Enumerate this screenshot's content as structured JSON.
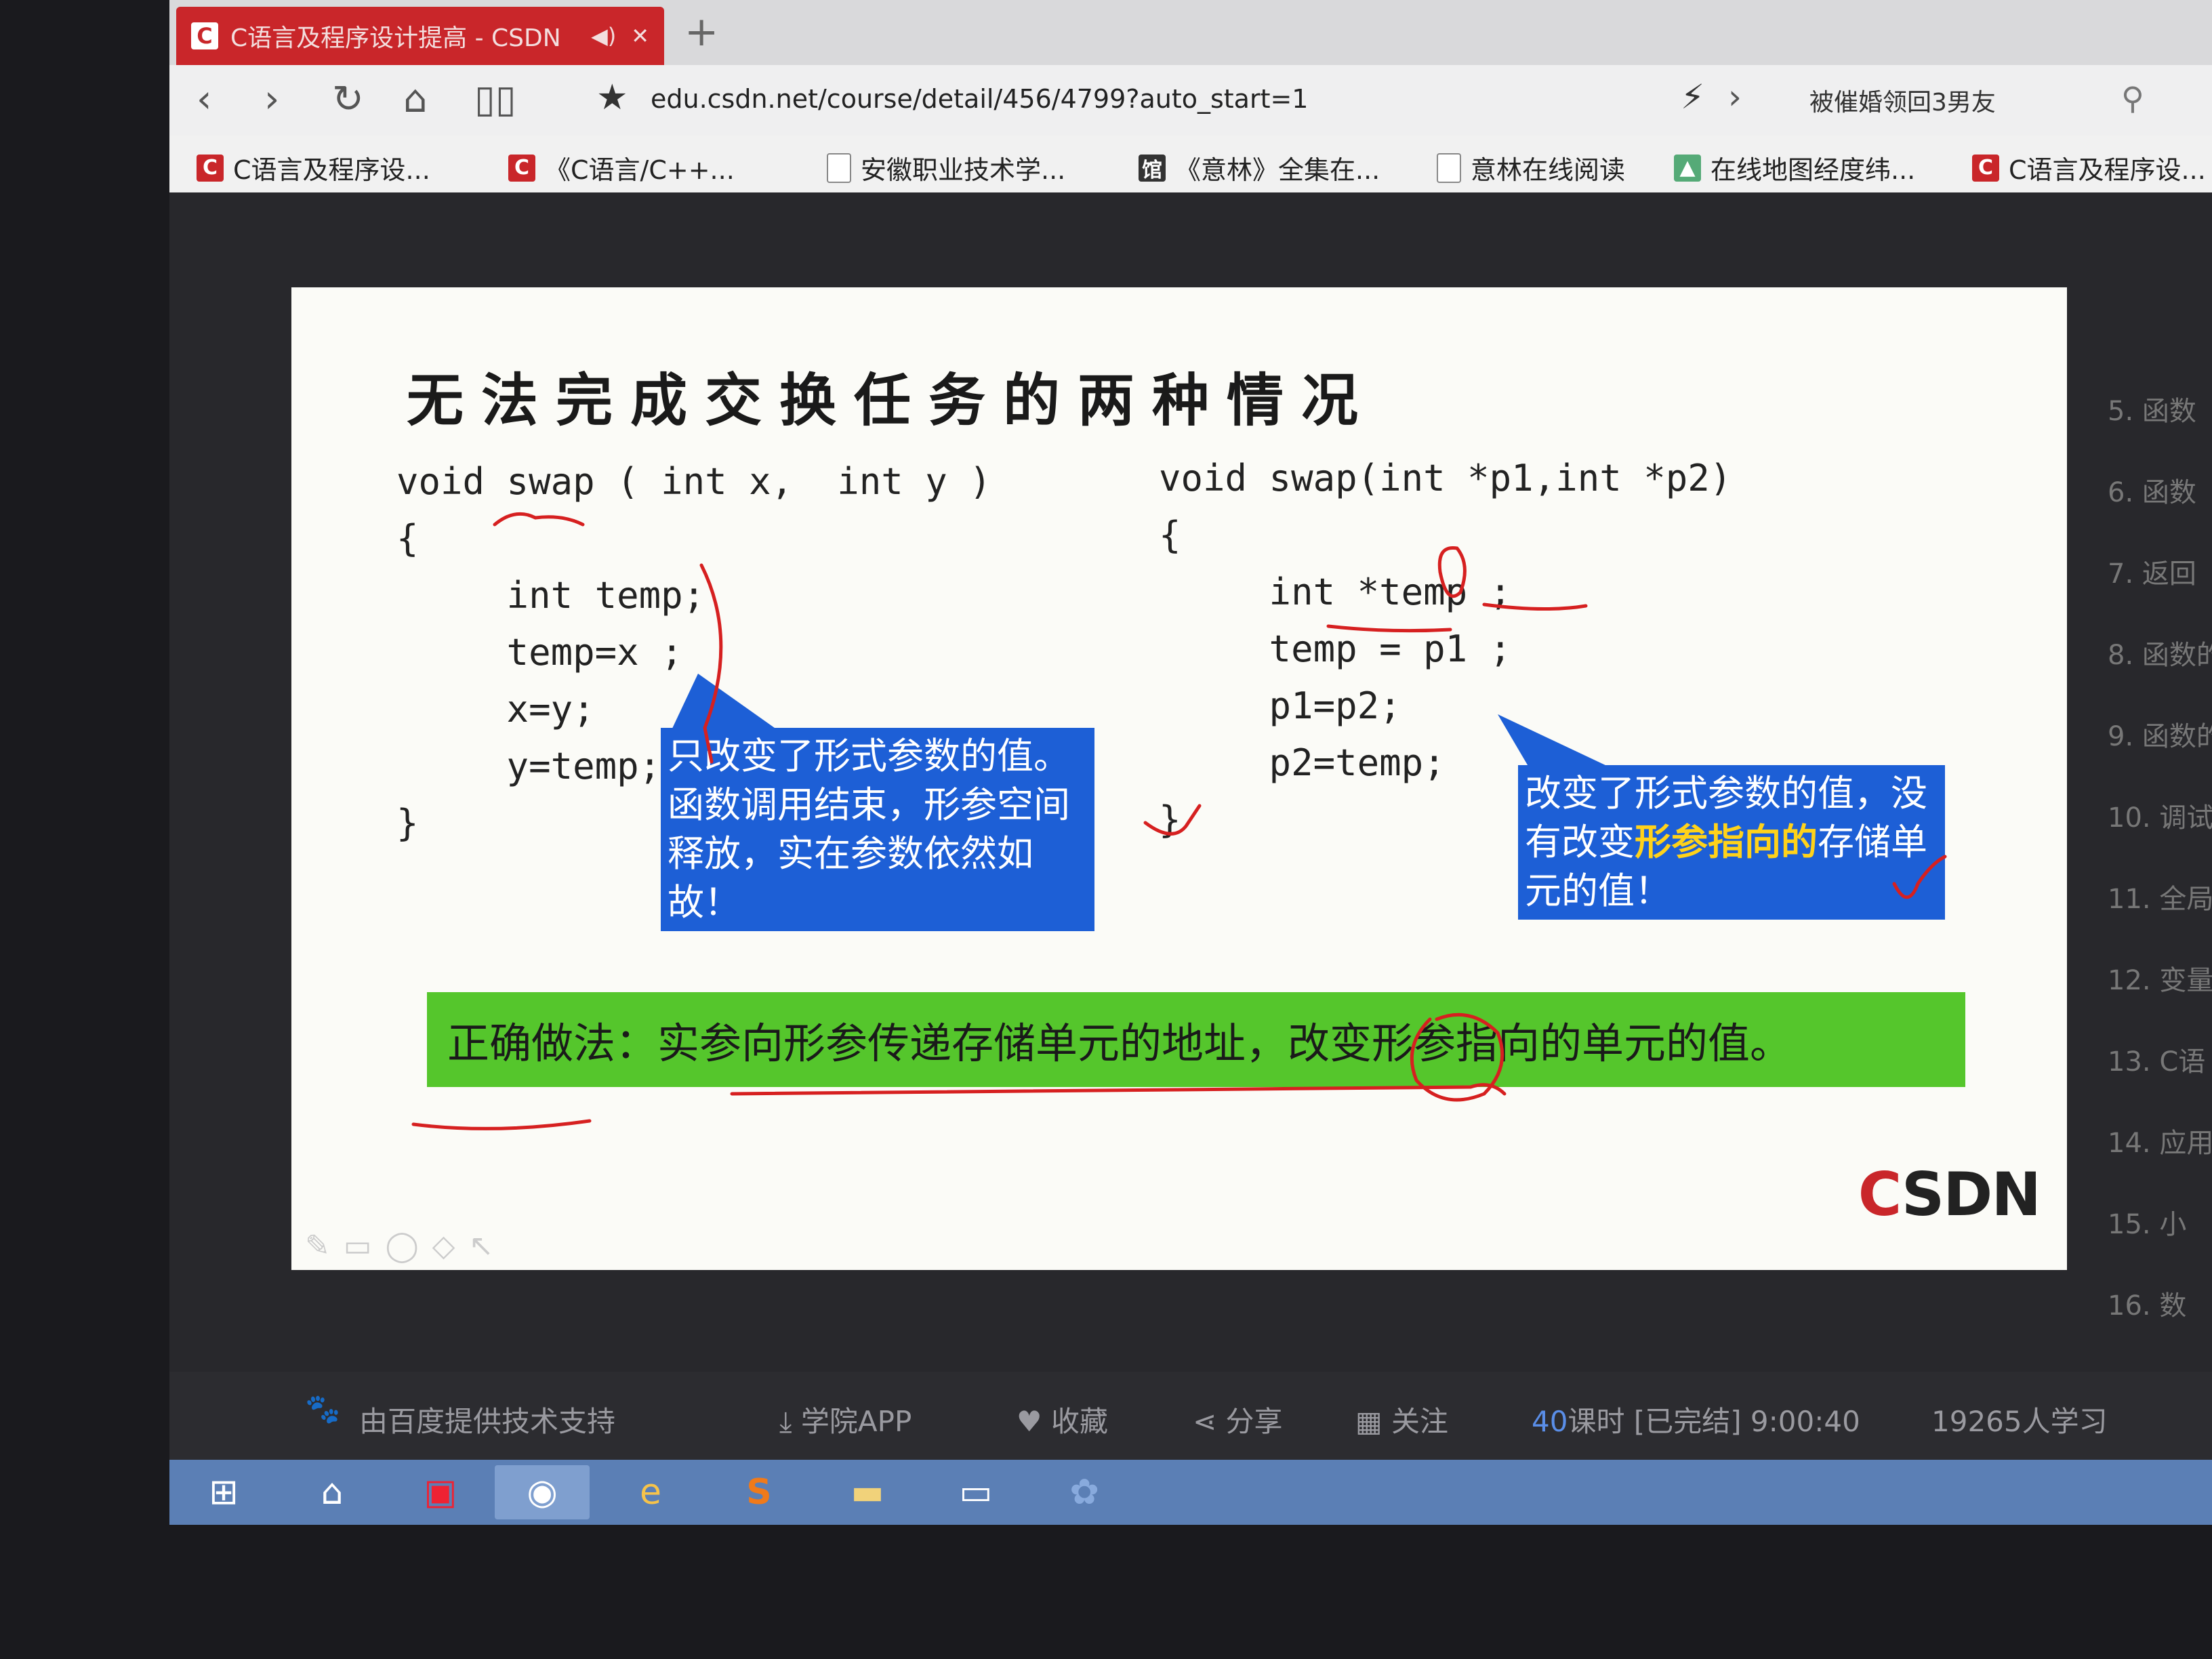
{
  "browser": {
    "tab_title": "C语言及程序设计提高 - CSDN",
    "tab_sound": "◀)",
    "tab_close": "✕",
    "new_tab": "+",
    "url": "edu.csdn.net/course/detail/456/4799?auto_start=1",
    "hot_search": "被催婚领回3男友"
  },
  "bookmarks": [
    {
      "label": "C语言及程序设...",
      "icon": "csdn-icon"
    },
    {
      "label": "《C语言/C++...",
      "icon": "csdn-icon"
    },
    {
      "label": "安徽职业技术学...",
      "icon": "page-icon"
    },
    {
      "label": "《意林》全集在...",
      "icon": "library-icon"
    },
    {
      "label": "意林在线阅读",
      "icon": "page-icon"
    },
    {
      "label": "在线地图经度纬...",
      "icon": "map-icon"
    },
    {
      "label": "C语言及程序设...",
      "icon": "csdn-icon"
    }
  ],
  "slide": {
    "title": "无法完成交换任务的两种情况",
    "left_code": "void swap ( int x,  int y )\n{\n     int temp;\n     temp=x ;\n     x=y;\n     y=temp;\n}",
    "right_code": "void swap(int *p1,int *p2)\n{\n     int *temp ;\n     temp = p1 ;\n     p1=p2;\n     p2=temp;\n}",
    "left_note": "只改变了形式参数的值。函数调用结束，形参空间释放，实在参数依然如故！",
    "right_note_a": "改变了形式参数的值，没有改变",
    "right_note_highlight": "形参指向的",
    "right_note_b": "存储单元的值！",
    "correct_method": "正确做法：实参向形参传递存储单元的地址，改变形参指向的单元的值。",
    "logo_c": "C",
    "logo_rest": "SDN"
  },
  "chapters": [
    "5. 函数",
    "6. 函数",
    "7. 返回",
    "8. 函数的",
    "9. 函数的",
    "10. 调试",
    "11. 全局",
    "12. 变量",
    "13. C语",
    "14. 应用",
    "15. 小",
    "16. 数"
  ],
  "player_bar": {
    "baidu": "由百度提供技术支持",
    "app": "学院APP",
    "favorite": "收藏",
    "share": "分享",
    "follow": "关注",
    "lessons_num": "40",
    "lessons": "课时 [已完结] 9:00:40",
    "learners": "19265人学习"
  },
  "colors": {
    "csdn_red": "#c9262a",
    "callout_blue": "#1d5fd6",
    "answer_green": "#55c62c",
    "ink_red": "#d62020"
  }
}
